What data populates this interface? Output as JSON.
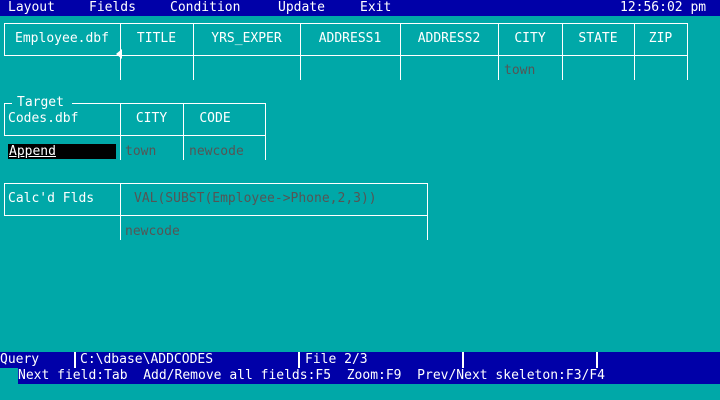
{
  "menu": {
    "items": [
      "Layout",
      "Fields",
      "Condition",
      "Update",
      "Exit"
    ],
    "clock": "12:56:02 pm"
  },
  "file_skeleton": {
    "file_name": "Employee.dbf",
    "fields": [
      "TITLE",
      "YRS_EXPER",
      "ADDRESS1",
      "ADDRESS2",
      "CITY",
      "STATE",
      "ZIP"
    ],
    "city_value": "town"
  },
  "target_skeleton": {
    "label": "Target",
    "file_name": "Codes.dbf",
    "fields": [
      "CITY",
      "CODE"
    ],
    "operator": "Append",
    "city_value": "town",
    "code_value": "newcode"
  },
  "calc_skeleton": {
    "label": "Calc'd Flds",
    "expression": "VAL(SUBST(Employee->Phone,2,3))",
    "name_value": "newcode"
  },
  "status_bar": {
    "mode": "Query",
    "path": "C:\\dbase\\ADDCODES",
    "file_indicator": "File 2/3"
  },
  "nav_line": "Next field:Tab  Add/Remove all fields:F5  Zoom:F9  Prev/Next skeleton:F3/F4",
  "colors": {
    "background": "#00a8a8",
    "bar": "#0000a8",
    "foreground": "#ffffff",
    "value_text": "#555555",
    "highlight": "#000000"
  }
}
